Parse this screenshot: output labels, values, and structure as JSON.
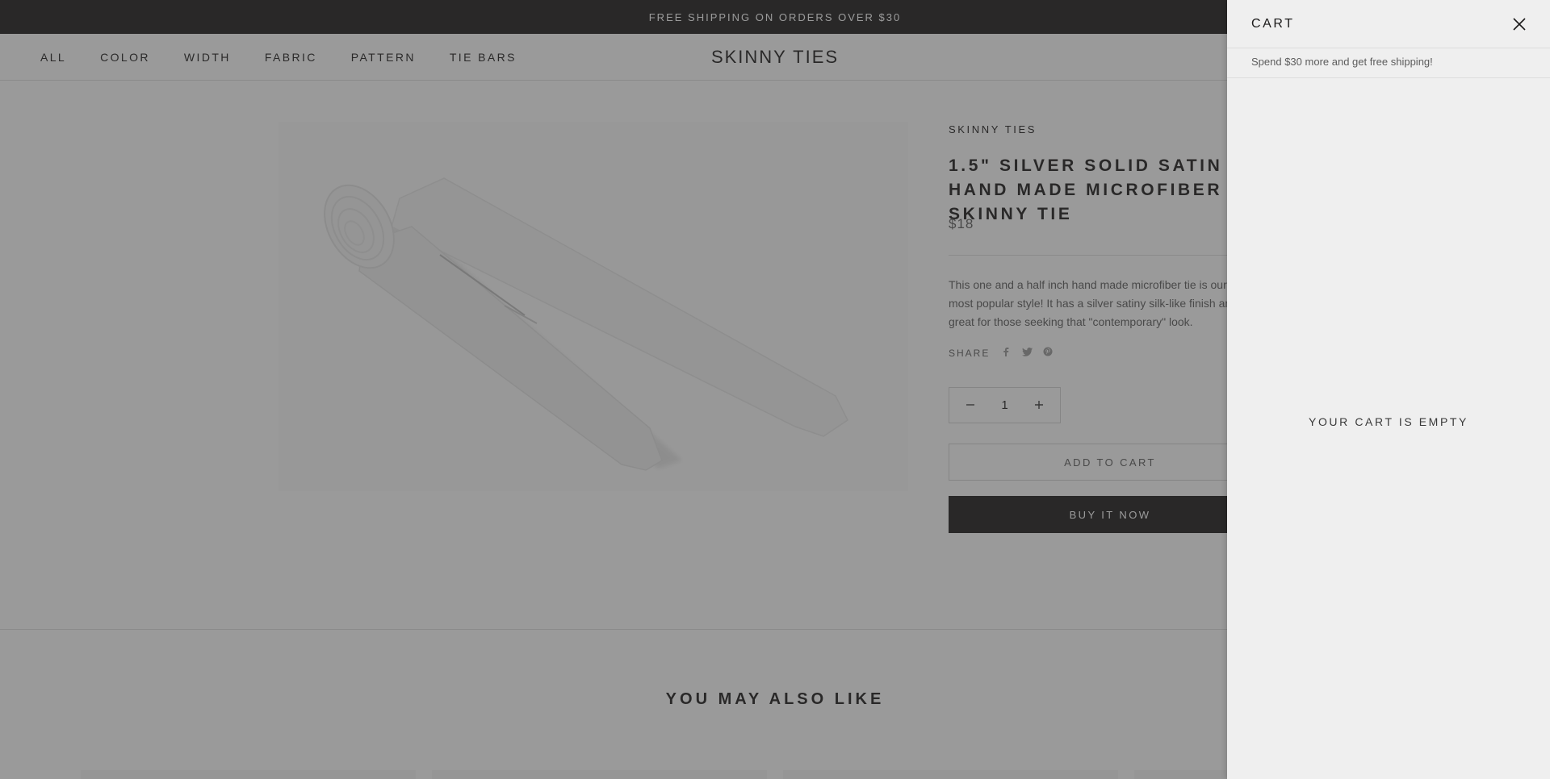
{
  "announcement": "FREE SHIPPING ON ORDERS OVER $30",
  "nav": {
    "items": [
      "ALL",
      "COLOR",
      "WIDTH",
      "FABRIC",
      "PATTERN",
      "TIE BARS"
    ]
  },
  "logo": "SKINNY TIES",
  "product": {
    "vendor": "SKINNY TIES",
    "title": "1.5\" Silver Solid Satin Hand Made Microfiber Skinny Tie",
    "price": "$18",
    "description": "This one and a half inch hand made microfiber tie is our most popular style! It has a silver satiny silk-like finish and is great for those seeking that \"contemporary\" look.",
    "share_label": "SHARE",
    "share_icons": [
      "facebook-icon",
      "twitter-icon",
      "pinterest-icon"
    ],
    "quantity": "1",
    "add_to_cart": "ADD TO CART",
    "buy_now": "BUY IT NOW"
  },
  "recommendations": {
    "heading": "YOU MAY ALSO LIKE"
  },
  "cart": {
    "title": "CART",
    "shipping_message": "Spend $30 more and get free shipping!",
    "empty_message": "YOUR CART IS EMPTY"
  },
  "colors": {
    "dark": "#1c1b1b",
    "drawer_bg": "#efefef",
    "overlay": "rgba(54,54,54,0.5)"
  }
}
